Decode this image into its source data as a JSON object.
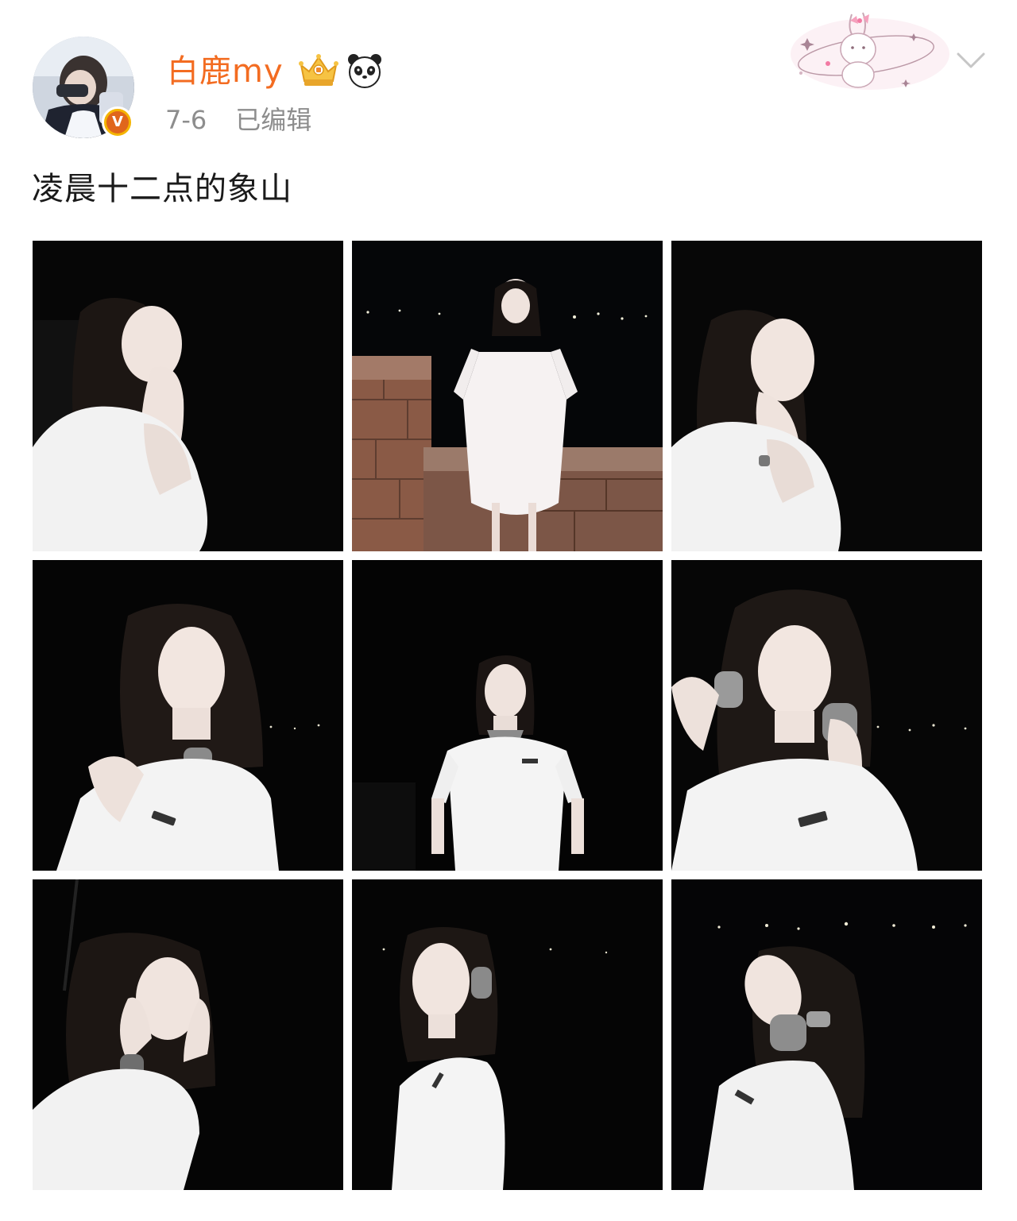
{
  "post": {
    "username": "白鹿my",
    "date": "7-6",
    "edited_label": "已编辑",
    "text": "凌晨十二点的象山",
    "verified_badge_label": "V",
    "icons": {
      "crown": "crown-vip-icon",
      "panda": "panda-emoji-icon",
      "menu": "chevron-down-icon",
      "sticker": "bunny-sticker-decoration"
    },
    "colors": {
      "username": "#f36c21",
      "meta": "#8d8d8d",
      "text": "#1a1a1a",
      "verified": "#f4b400",
      "photo_bg": "#050505"
    }
  },
  "photos": [
    {
      "name": "photo-1",
      "description_icon": "woman-hand-on-cheek"
    },
    {
      "name": "photo-2",
      "description_icon": "woman-standing-by-brick-wall"
    },
    {
      "name": "photo-3",
      "description_icon": "woman-chin-on-hands"
    },
    {
      "name": "photo-4",
      "description_icon": "woman-headphones-on-neck"
    },
    {
      "name": "photo-5",
      "description_icon": "woman-standing-night"
    },
    {
      "name": "photo-6",
      "description_icon": "woman-holding-headphones"
    },
    {
      "name": "photo-7",
      "description_icon": "woman-hands-on-face"
    },
    {
      "name": "photo-8",
      "description_icon": "woman-eyes-closed-headphones"
    },
    {
      "name": "photo-9",
      "description_icon": "woman-looking-up-headphones"
    }
  ]
}
